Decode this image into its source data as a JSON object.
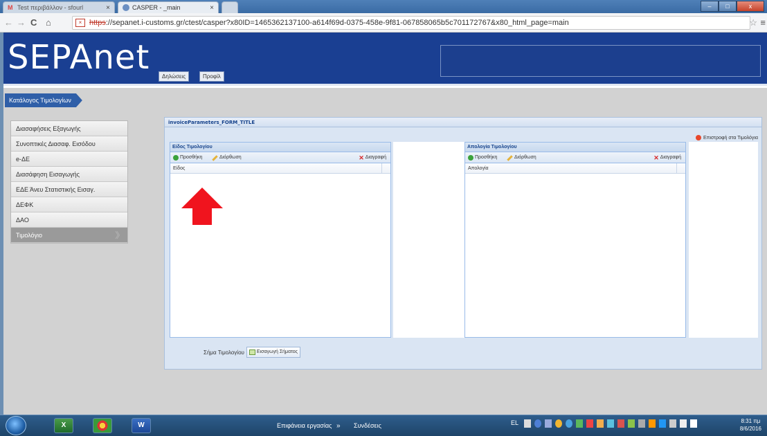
{
  "browser": {
    "tabs": [
      {
        "label": "Test περιβάλλον - sfourl",
        "active": false
      },
      {
        "label": "CASPER - _main",
        "active": true
      }
    ],
    "url_scheme": "https",
    "url_rest": "://sepanet.i-customs.gr/ctest/casper?x80ID=1465362137100-a614f69d-0375-458e-9f81-067858065b5c701172767&x80_html_page=main",
    "icons": [
      "back-icon",
      "forward-icon",
      "reload-icon",
      "home-icon",
      "star-icon",
      "menu-icon"
    ]
  },
  "header": {
    "logo": "SEPAnet",
    "buttons": [
      "Δηλώσεις",
      "Προφίλ"
    ]
  },
  "breadcrumb": "Κατάλογος Τιμολογίων",
  "sidebar": {
    "items": [
      {
        "label": "Διασαφήσεις Εξαγωγής",
        "active": false
      },
      {
        "label": "Συνοπτικές Διασαφ. Εισόδου",
        "active": false
      },
      {
        "label": "e-ΔΕ",
        "active": false
      },
      {
        "label": "Διασάφηση Εισαγωγής",
        "active": false
      },
      {
        "label": "ΕΔΕ Άνευ Στατιστικής Εισαγ.",
        "active": false
      },
      {
        "label": "ΔΕΦΚ",
        "active": false
      },
      {
        "label": "ΔΑΟ",
        "active": false
      },
      {
        "label": "Τιμολόγιο",
        "active": true
      }
    ]
  },
  "form": {
    "title": "invoiceParameters_FORM_TITLE",
    "back_link": "Επιστροφή στα Τιμολόγια",
    "left_panel": {
      "title": "Είδος Τιμολογίου",
      "add": "Προσθήκη",
      "edit": "Διόρθωση",
      "delete": "Διαγραφή",
      "column": "Είδος"
    },
    "right_panel": {
      "title": "Απολογία Τιμολογίου",
      "add": "Προσθήκη",
      "edit": "Διόρθωση",
      "delete": "Διαγραφή",
      "column": "Απολογία"
    },
    "image_label": "Σήμα Τιμολογίου",
    "import_button": "Εισαγωγή Σήματος"
  },
  "annotation": {
    "color": "#f0141e",
    "icon": "red-up-arrow-icon"
  },
  "taskbar": {
    "desktop_label": "Επιφάνεια εργασίας",
    "connections_label": "Συνδέσεις",
    "language": "EL",
    "time": "8:31 πμ",
    "date": "8/6/2016",
    "pinned": [
      "excel-icon",
      "chrome-icon",
      "word-icon"
    ]
  }
}
